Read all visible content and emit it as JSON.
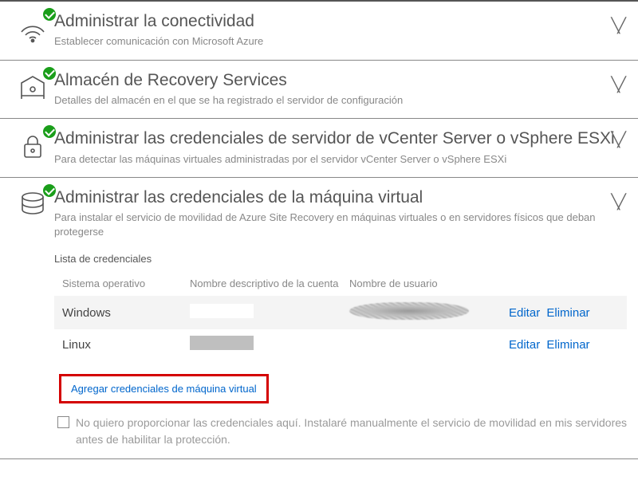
{
  "sections": {
    "connectivity": {
      "title": "Administrar la conectividad",
      "subtitle": "Establecer comunicación con Microsoft Azure"
    },
    "vault": {
      "title": "Almacén de Recovery Services",
      "subtitle": "Detalles del almacén en el que se ha registrado el servidor de configuración"
    },
    "vcenter": {
      "title": "Administrar las credenciales de servidor de vCenter Server o vSphere ESXi",
      "subtitle": "Para detectar las máquinas virtuales administradas por el servidor vCenter Server o vSphere ESXi"
    },
    "vmcred": {
      "title": "Administrar las credenciales de la máquina virtual",
      "subtitle": "Para instalar el servicio de movilidad de Azure Site Recovery en máquinas virtuales o en servidores físicos que deban protegerse"
    }
  },
  "vmcred_detail": {
    "list_heading": "Lista de credenciales",
    "columns": {
      "os": "Sistema operativo",
      "friendly": "Nombre descriptivo de la cuenta",
      "user": "Nombre de usuario"
    },
    "rows": [
      {
        "os": "Windows"
      },
      {
        "os": "Linux"
      }
    ],
    "actions": {
      "edit": "Editar",
      "delete": "Eliminar"
    },
    "add_link": "Agregar credenciales de máquina virtual",
    "opt_out_text": "No quiero proporcionar las credenciales aquí. Instalaré manualmente el servicio de movilidad en mis servidores antes de habilitar la protección."
  }
}
